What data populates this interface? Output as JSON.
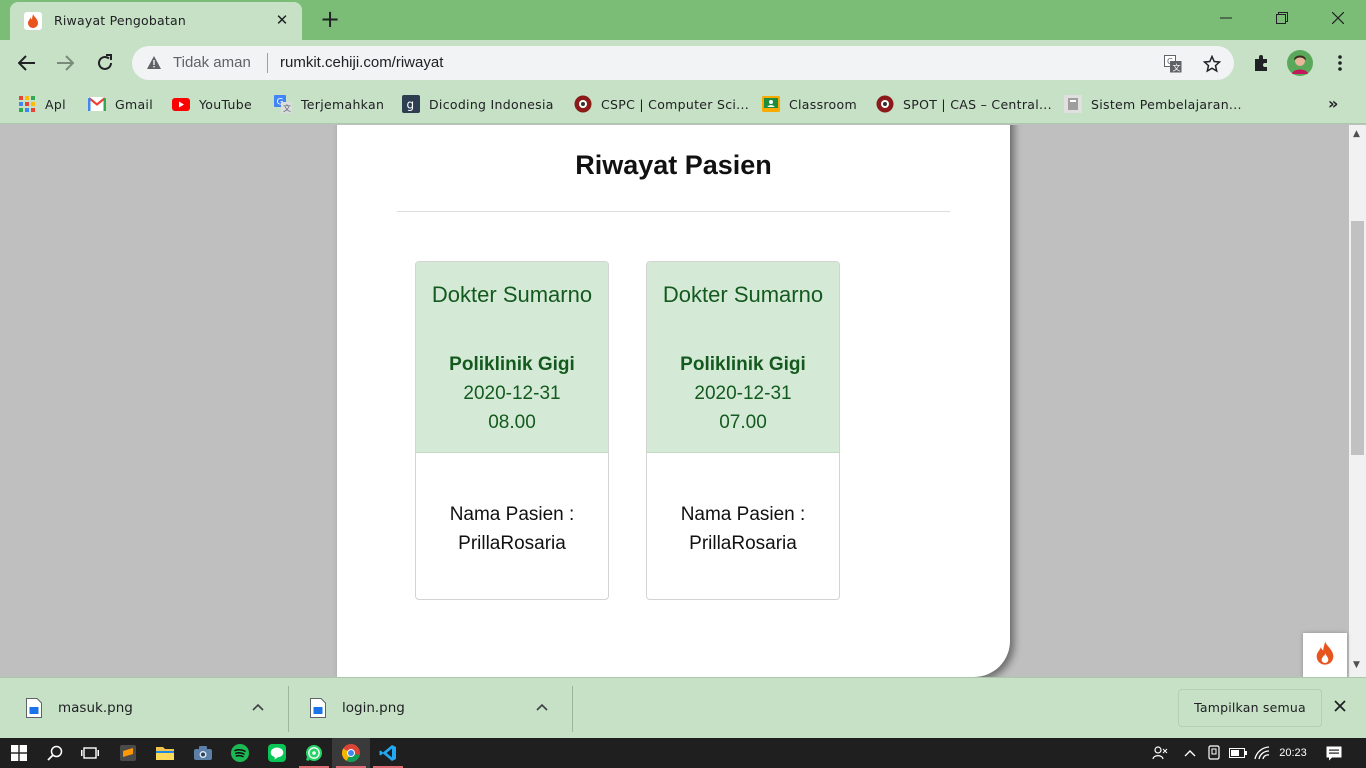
{
  "browser": {
    "tab_title": "Riwayat Pengobatan",
    "tab_close": "✕",
    "new_tab": "+",
    "security_label": "Tidak aman",
    "url": "rumkit.cehiji.com/riwayat"
  },
  "bookmarks": {
    "items": [
      {
        "label": "Apl",
        "icon": "apps-grid-icon"
      },
      {
        "label": "Gmail",
        "icon": "gmail-icon"
      },
      {
        "label": "YouTube",
        "icon": "youtube-icon"
      },
      {
        "label": "Terjemahkan",
        "icon": "translate-icon"
      },
      {
        "label": "Dicoding Indonesia",
        "icon": "dicoding-icon"
      },
      {
        "label": "CSPC | Computer Sci...",
        "icon": "cspc-icon"
      },
      {
        "label": "Classroom",
        "icon": "classroom-icon"
      },
      {
        "label": "SPOT | CAS – Central...",
        "icon": "spot-icon"
      },
      {
        "label": "Sistem Pembelajaran...",
        "icon": "sistem-icon"
      }
    ],
    "more": "»"
  },
  "page": {
    "title": "Riwayat Pasien",
    "cards": [
      {
        "doctor": "Dokter Sumarno",
        "clinic": "Poliklinik Gigi",
        "date": "2020-12-31",
        "time": "08.00",
        "patient_label": "Nama Pasien :",
        "patient_name": "PrillaRosaria"
      },
      {
        "doctor": "Dokter Sumarno",
        "clinic": "Poliklinik Gigi",
        "date": "2020-12-31",
        "time": "07.00",
        "patient_label": "Nama Pasien :",
        "patient_name": "PrillaRosaria"
      }
    ]
  },
  "downloads": {
    "items": [
      {
        "name": "masuk.png"
      },
      {
        "name": "login.png"
      }
    ],
    "show_all": "Tampilkan semua"
  },
  "taskbar": {
    "clock": "20:23"
  },
  "colors": {
    "chrome_dark": "#7bbd77",
    "chrome_light": "#c6e1c5",
    "card_header": "#d4ead6",
    "card_text": "#145a1f"
  }
}
